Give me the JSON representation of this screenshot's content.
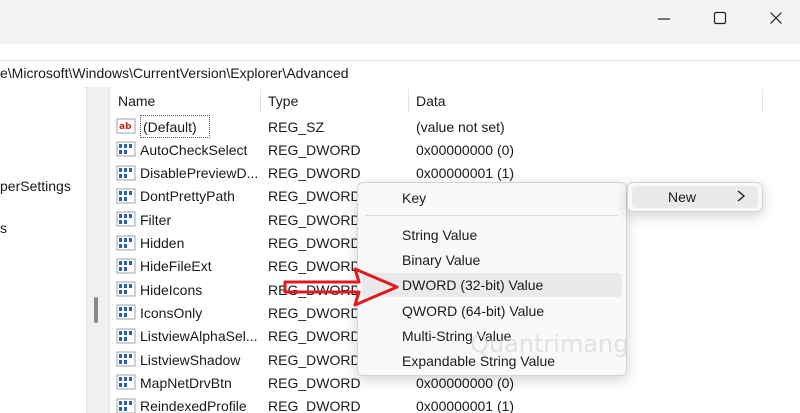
{
  "window": {
    "minimize_icon": "minimize-icon",
    "maximize_icon": "maximize-icon",
    "close_icon": "close-icon"
  },
  "address": {
    "path": "e\\Microsoft\\Windows\\CurrentVersion\\Explorer\\Advanced"
  },
  "tree": {
    "items": [
      "perSettings",
      "s"
    ]
  },
  "columns": {
    "name": "Name",
    "type": "Type",
    "data": "Data"
  },
  "rows": [
    {
      "name": "(Default)",
      "type": "REG_SZ",
      "data": "(value not set)",
      "icon": "string-value-icon"
    },
    {
      "name": "AutoCheckSelect",
      "type": "REG_DWORD",
      "data": "0x00000000 (0)",
      "icon": "dword-value-icon"
    },
    {
      "name": "DisablePreviewD...",
      "type": "REG_DWORD",
      "data": "0x00000001 (1)",
      "icon": "dword-value-icon"
    },
    {
      "name": "DontPrettyPath",
      "type": "REG_DWORD",
      "data": "",
      "icon": "dword-value-icon"
    },
    {
      "name": "Filter",
      "type": "REG_DWORD",
      "data": "",
      "icon": "dword-value-icon"
    },
    {
      "name": "Hidden",
      "type": "REG_DWORD",
      "data": "",
      "icon": "dword-value-icon"
    },
    {
      "name": "HideFileExt",
      "type": "REG_DWORD",
      "data": "",
      "icon": "dword-value-icon"
    },
    {
      "name": "HideIcons",
      "type": "REG_DWORD",
      "data": "",
      "icon": "dword-value-icon"
    },
    {
      "name": "IconsOnly",
      "type": "REG_DWORD",
      "data": "",
      "icon": "dword-value-icon"
    },
    {
      "name": "ListviewAlphaSel...",
      "type": "REG_DWORD",
      "data": "",
      "icon": "dword-value-icon"
    },
    {
      "name": "ListviewShadow",
      "type": "REG_DWORD",
      "data": "",
      "icon": "dword-value-icon"
    },
    {
      "name": "MapNetDrvBtn",
      "type": "REG_DWORD",
      "data": "0x00000000 (0)",
      "icon": "dword-value-icon"
    },
    {
      "name": "ReindexedProfile",
      "type": "REG_DWORD",
      "data": "0x00000001 (1)",
      "icon": "dword-value-icon"
    }
  ],
  "context_menu": {
    "items": [
      "Key",
      "String Value",
      "Binary Value",
      "DWORD (32-bit) Value",
      "QWORD (64-bit) Value",
      "Multi-String Value",
      "Expandable String Value"
    ],
    "highlighted": "DWORD (32-bit) Value"
  },
  "new_menu": {
    "label": "New",
    "chevron_icon": "chevron-right-icon"
  },
  "watermark": {
    "text": "Quantrimang"
  },
  "colors": {
    "arrow": "#e0191e",
    "icon_blue": "#2a5fb0",
    "icon_red": "#c3261c",
    "menu_bg": "#f9f9f9",
    "highlight": "#eaeaea"
  }
}
